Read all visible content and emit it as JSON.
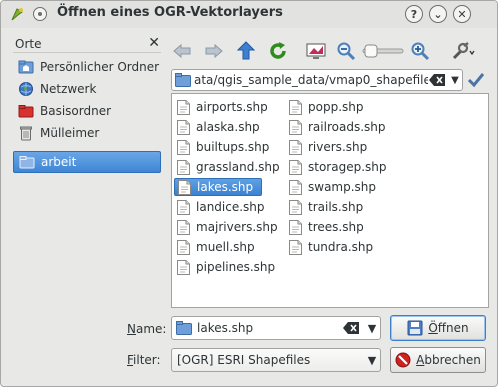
{
  "window": {
    "title": "Öffnen eines OGR-Vektorlayers",
    "controls": [
      "?",
      "⌄",
      "✕"
    ]
  },
  "sidebar": {
    "header": "Orte",
    "close": "✕",
    "items": [
      {
        "label": "Persönlicher Ordner",
        "icon": "home-folder-icon"
      },
      {
        "label": "Netzwerk",
        "icon": "network-icon"
      },
      {
        "label": "Basisordner",
        "icon": "root-folder-icon"
      },
      {
        "label": "Mülleimer",
        "icon": "trash-icon"
      },
      {
        "label": "arbeit",
        "icon": "folder-icon",
        "selected": true
      }
    ]
  },
  "toolbar": {
    "buttons": [
      "back-arrow-icon",
      "forward-arrow-icon",
      "up-arrow-icon",
      "reload-icon",
      "preview-icon",
      "zoom-out-icon",
      "zoom-slider",
      "zoom-in-icon",
      "settings-icon"
    ]
  },
  "path": {
    "value": "ata/qgis_sample_data/vmap0_shapefiles"
  },
  "files": {
    "column1": [
      "airports.shp",
      "alaska.shp",
      "builtups.shp",
      "grassland.shp",
      "lakes.shp",
      "landice.shp",
      "majrivers.shp",
      "muell.shp",
      "pipelines.shp"
    ],
    "column2": [
      "popp.shp",
      "railroads.shp",
      "rivers.shp",
      "storagep.shp",
      "swamp.shp",
      "trails.shp",
      "trees.shp",
      "tundra.shp"
    ],
    "selected": "lakes.shp"
  },
  "name_field": {
    "label_prefix": "N",
    "label_rest": "ame:",
    "value": "lakes.shp"
  },
  "filter_field": {
    "label_prefix": "F",
    "label_rest": "ilter:",
    "value": "[OGR] ESRI Shapefiles"
  },
  "buttons": {
    "open_prefix": "Ö",
    "open_rest": "ffnen",
    "cancel_prefix": "A",
    "cancel_rest": "bbrechen"
  },
  "colors": {
    "selection": "#4a90d9",
    "window_bg": "#e8e8e7",
    "accent_green": "#3a9a1a"
  }
}
